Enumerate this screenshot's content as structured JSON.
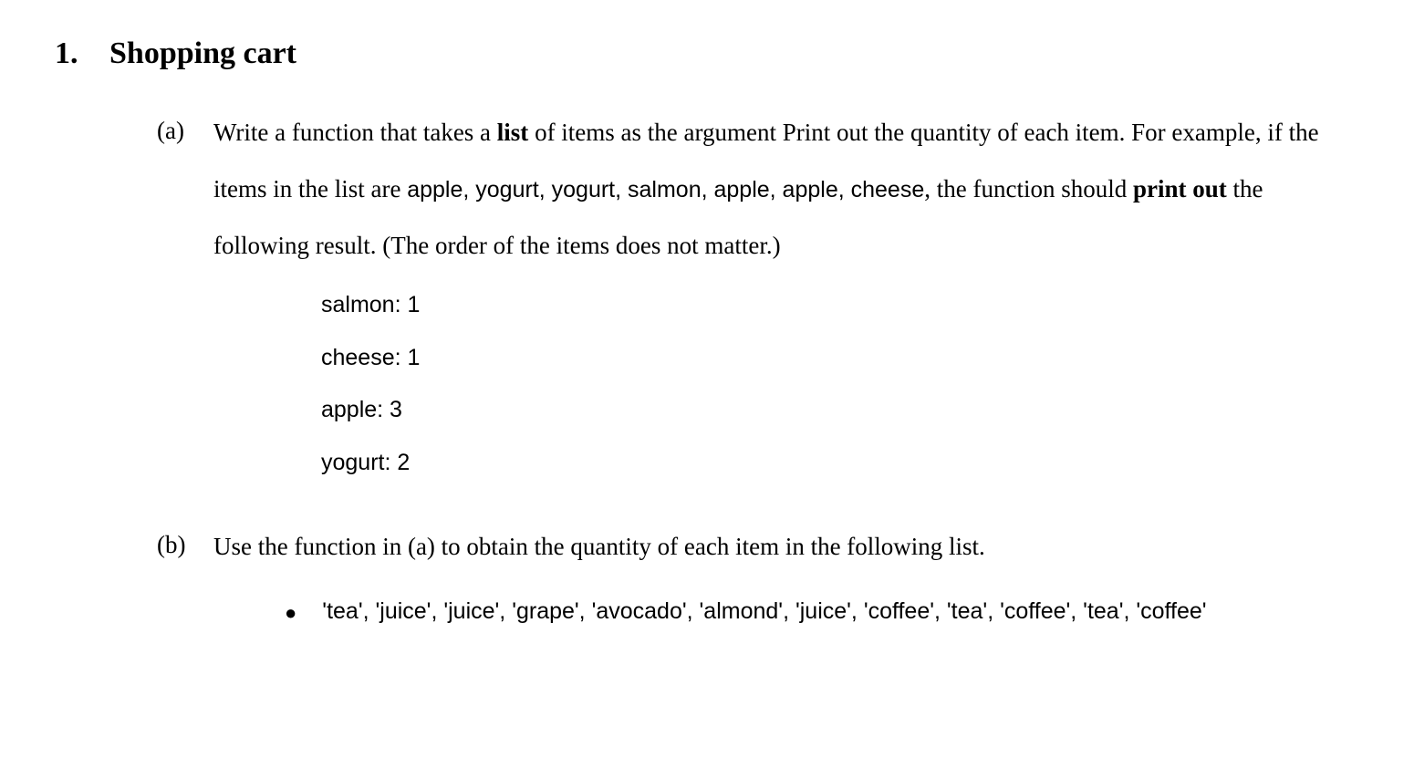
{
  "problem": {
    "number": "1.",
    "title": "Shopping cart",
    "parts": {
      "a": {
        "label": "(a)",
        "text_before_bold1": "Write a function that takes a ",
        "bold1": "list",
        "text_after_bold1_before_mono1": " of items as the argument Print out the quantity of each item. For example, if the items in the list are ",
        "mono1": "apple, yogurt, yogurt, salmon, apple, apple, cheese",
        "text_after_mono1_before_bold2": ", the function should ",
        "bold2": "print out",
        "text_after_bold2": " the following result. (The order of the items does not matter.)",
        "output": [
          "salmon: 1",
          "cheese: 1",
          "apple: 3",
          "yogurt: 2"
        ]
      },
      "b": {
        "label": "(b)",
        "text": "Use the function in (a) to obtain the quantity of each item in the following list.",
        "bullet": "'tea', 'juice', 'juice', 'grape', 'avocado', 'almond', 'juice', 'coffee', 'tea', 'coffee', 'tea', 'coffee'"
      }
    }
  }
}
